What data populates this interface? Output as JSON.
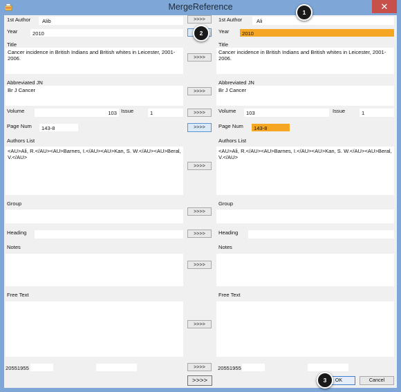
{
  "window": {
    "title": "MergeReference",
    "close_glyph": "✕"
  },
  "left": {
    "first_author_label": "1st Author",
    "first_author": "Alib",
    "year_label": "Year",
    "year": "2010",
    "title_label": "Title",
    "title": "Cancer incidence in British Indians and British whites in Leicester, 2001-2006.",
    "abbrev_label": "Abbreviated JN",
    "abbrev": "Br J Cancer",
    "volume_label": "Volume",
    "volume": "103",
    "issue_label": "Issue",
    "issue": "1",
    "pagenum_label": "Page Num",
    "pagenum": "143-8",
    "authors_label": "Authors List",
    "authors": "<AU>Ali, R.</AU><AU>Barnes, I.</AU><AU>Kan, S. W.</AU><AU>Beral, V.</AU>",
    "group_label": "Group",
    "group": "",
    "heading_label": "Heading",
    "heading": "",
    "notes_label": "Notes",
    "notes": "",
    "freetext_label": "Free Text",
    "freetext": "",
    "id": "20551955",
    "extra": ""
  },
  "right": {
    "first_author_label": "1st Author",
    "first_author": "Ali",
    "year_label": "Year",
    "year": "2010",
    "title_label": "Title",
    "title": "Cancer incidence in British Indians and British whites in Leicester, 2001-2006.",
    "abbrev_label": "Abbreviated JN",
    "abbrev": "Br J Cancer",
    "volume_label": "Volume",
    "volume": "103",
    "issue_label": "Issue",
    "issue": "1",
    "pagenum_label": "Page Num",
    "pagenum": "143-8",
    "authors_label": "Authors List",
    "authors": "<AU>Ali, R.</AU><AU>Barnes, I.</AU><AU>Kan, S. W.</AU><AU>Beral, V.</AU>",
    "group_label": "Group",
    "group": "",
    "heading_label": "Heading",
    "heading": "",
    "notes_label": "Notes",
    "notes": "",
    "freetext_label": "Free Text",
    "freetext": "",
    "id": "20551955",
    "extra": ""
  },
  "buttons": {
    "copy": ">>>>",
    "copy_all": ">>>>",
    "ok": "OK",
    "cancel": "Cancel"
  },
  "callouts": [
    "1",
    "2",
    "3"
  ],
  "colors": {
    "highlight": "#f5a623",
    "titlebar": "#7ea6d6",
    "close": "#c7504b"
  }
}
